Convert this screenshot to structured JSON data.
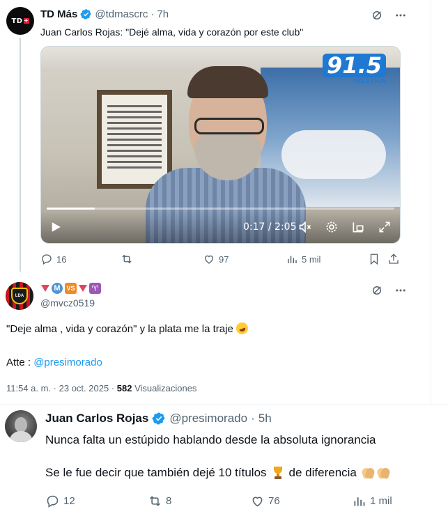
{
  "quoted_tweet": {
    "avatar_text": "TD",
    "name": "TD Más",
    "handle": "@tdmascrc",
    "separator": "·",
    "time": "7h",
    "text": "Juan Carlos Rojas: \"Dejé alma, vida y corazón por este club\"",
    "video": {
      "brand_number": "91.5",
      "brand_sub": "TELETICA",
      "time_display": "0:17 / 2:05",
      "progress_fraction": 0.138
    },
    "actions": {
      "replies": "16",
      "retweets": "",
      "likes": "97",
      "views": "5 mil"
    }
  },
  "main_tweet": {
    "avatar_text": "LDA",
    "handle": "@mvcz0519",
    "emoji_name_letters": {
      "m": "M",
      "vs": "VS",
      "aries": "♈"
    },
    "text_line1": "\"Deje alma , vida y corazón\" y la plata me la traje",
    "text_prefix": "Atte : ",
    "mention": "@presimorado",
    "timestamp": "11:54 a. m. · 23 oct. 2025 · ",
    "views_count": "582",
    "views_label": " Visualizaciones"
  },
  "reply": {
    "name": "Juan Carlos Rojas",
    "handle": "@presimorado",
    "separator": "·",
    "time": "5h",
    "text_line1": "Nunca falta un estúpido hablando desde la absoluta ignorancia",
    "text_line2_a": "Se le fue decir que también dejé 10 títulos",
    "text_line2_b": "de diferencia",
    "actions": {
      "replies": "12",
      "retweets": "8",
      "likes": "76",
      "views": "1 mil"
    }
  },
  "colors": {
    "text": "#0f1419",
    "muted": "#536471",
    "link": "#1d9bf0",
    "verified": "#1d9bf0",
    "divider": "#eff3f4"
  },
  "icons": {
    "more": "more-icon",
    "grok": "grok-icon",
    "reply": "reply-icon",
    "retweet": "retweet-icon",
    "like": "like-icon",
    "views": "views-icon",
    "bookmark": "bookmark-icon",
    "share": "share-icon"
  }
}
